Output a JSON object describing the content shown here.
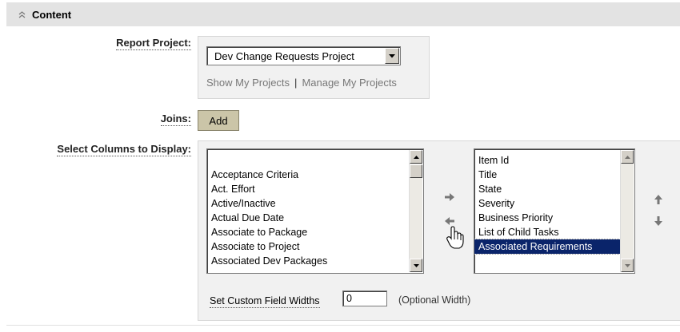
{
  "section": {
    "title": "Content",
    "collapse_icon": "chevron-double-up-icon"
  },
  "report_project": {
    "label": "Report Project:",
    "selected": "Dev Change Requests Project",
    "links": {
      "show": "Show My Projects",
      "separator": "|",
      "manage": "Manage My Projects"
    }
  },
  "joins": {
    "label": "Joins:",
    "add_label": "Add"
  },
  "columns": {
    "label": "Select Columns to Display:",
    "available": [
      "Acceptance Criteria",
      "Act. Effort",
      "Active/Inactive",
      "Actual Due Date",
      "Associate to Package",
      "Associate to Project",
      "Associated Dev Packages"
    ],
    "selected": [
      "Item Id",
      "Title",
      "State",
      "Severity",
      "Business Priority",
      "List of Child Tasks",
      "Associated Requirements"
    ],
    "highlighted": "Associated Requirements",
    "move_icons": [
      "arrow-right-icon",
      "arrow-left-icon",
      "arrow-up-icon",
      "arrow-down-icon"
    ]
  },
  "custom_width": {
    "label": "Set Custom Field Widths",
    "value": "0",
    "hint": "(Optional Width)"
  },
  "colors": {
    "header_bg": "#e3e3e3",
    "panel_bg": "#f1f1f1",
    "button_bg": "#cbc5a8",
    "highlight": "#0a246a"
  }
}
